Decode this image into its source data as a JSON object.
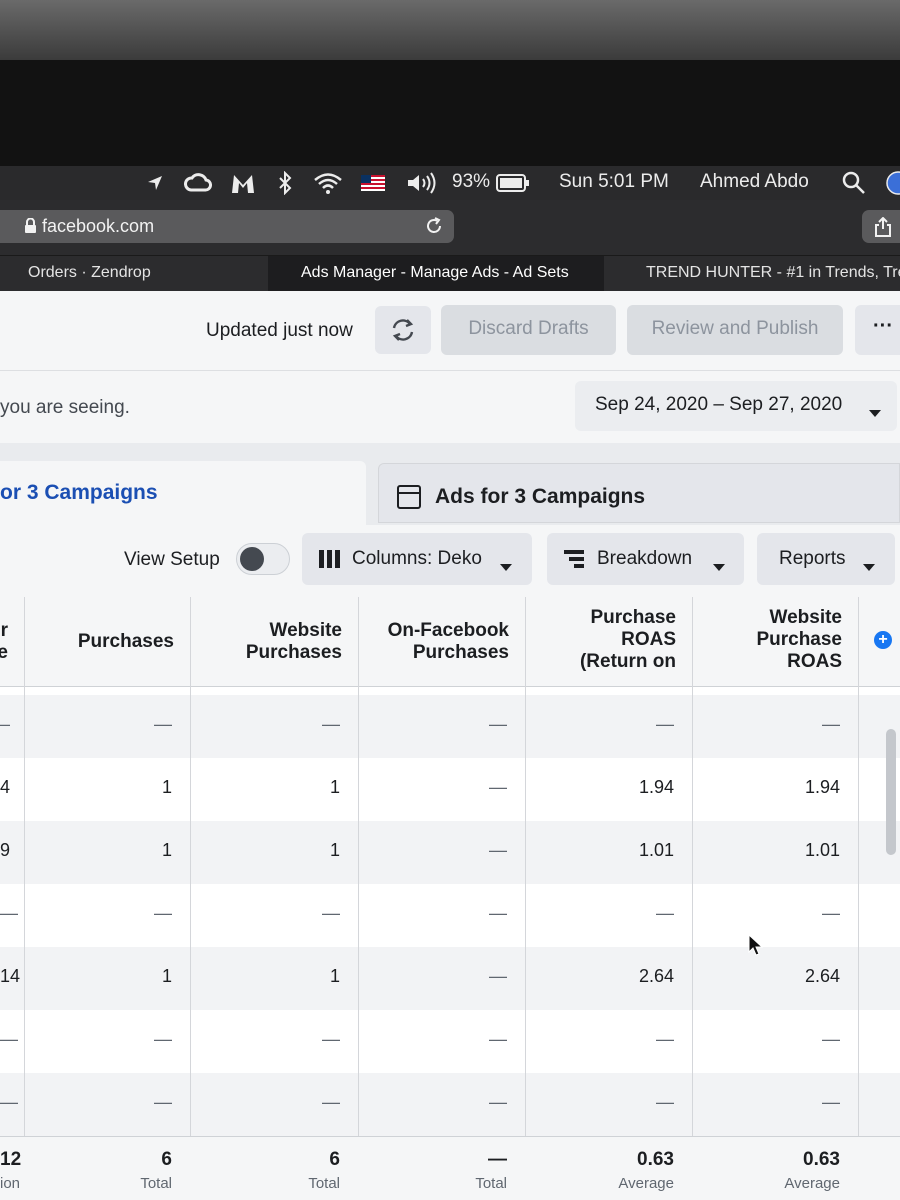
{
  "menubar": {
    "battery": "93%",
    "clock": "Sun 5:01 PM",
    "user": "Ahmed Abdo",
    "icons": [
      "location-icon",
      "creative-cloud-icon",
      "malwarebytes-icon",
      "bluetooth-icon",
      "wifi-icon",
      "us-flag-icon",
      "volume-icon",
      "battery-icon",
      "search-icon",
      "siri-icon"
    ]
  },
  "browser": {
    "url": "facebook.com",
    "tabs": [
      {
        "label": "Orders · Zendrop"
      },
      {
        "label": "Ads Manager - Manage Ads - Ad Sets"
      },
      {
        "label": "TREND HUNTER - #1 in Trends, Tre"
      }
    ]
  },
  "actions": {
    "updated": "Updated just now",
    "discard": "Discard Drafts",
    "review": "Review and Publish",
    "more": "···"
  },
  "filter": {
    "hint": "you are seeing.",
    "date_range": "Sep 24, 2020 – Sep 27, 2020"
  },
  "level_tabs": {
    "active": "or 3 Campaigns",
    "ads": "Ads for 3 Campaigns"
  },
  "controls": {
    "view_setup": "View Setup",
    "columns": "Columns: Deko",
    "breakdown": "Breakdown",
    "reports": "Reports"
  },
  "table": {
    "columns": [
      {
        "key": "partial",
        "label": "r\ne"
      },
      {
        "key": "purchases",
        "label": "Purchases"
      },
      {
        "key": "website_purchases",
        "label": "Website\nPurchases"
      },
      {
        "key": "onfb_purchases",
        "label": "On-Facebook\nPurchases"
      },
      {
        "key": "roas",
        "label": "Purchase\nROAS\n(Return on"
      },
      {
        "key": "web_roas",
        "label": "Website\nPurchase\nROAS"
      }
    ],
    "rows": [
      [
        "–",
        "—",
        "—",
        "—",
        "—",
        "—"
      ],
      [
        "4",
        "1",
        "1",
        "—",
        "1.94",
        "1.94"
      ],
      [
        "9",
        "1",
        "1",
        "—",
        "1.01",
        "1.01"
      ],
      [
        "—",
        "—",
        "—",
        "—",
        "—",
        "—"
      ],
      [
        "14",
        "1",
        "1",
        "—",
        "2.64",
        "2.64"
      ],
      [
        "—",
        "—",
        "—",
        "—",
        "—",
        "—"
      ],
      [
        "—",
        "—",
        "—",
        "—",
        "—",
        "—"
      ]
    ],
    "totals": [
      {
        "value": "12",
        "sub": "ion"
      },
      {
        "value": "6",
        "sub": "Total"
      },
      {
        "value": "6",
        "sub": "Total"
      },
      {
        "value": "—",
        "sub": "Total"
      },
      {
        "value": "0.63",
        "sub": "Average"
      },
      {
        "value": "0.63",
        "sub": "Average"
      }
    ]
  },
  "colors": {
    "accent": "#1b4fb3",
    "add_button": "#1877f2"
  }
}
